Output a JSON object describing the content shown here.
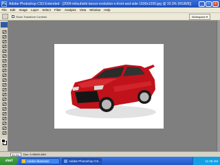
{
  "window": {
    "app_logo": "Ps",
    "title": "Adobe Photoshop CS3 Extended - [2009-mitsubishi-lancer-evolution-x-front-and-side 1600x1200.jpg @ 33.3% (RGB/8)]",
    "buttons": {
      "minimize": "_",
      "maximize": "□",
      "close": "×"
    }
  },
  "menubar": {
    "items": [
      "File",
      "Edit",
      "Image",
      "Layer",
      "Select",
      "Filter",
      "Analysis",
      "View",
      "Window",
      "Help"
    ]
  },
  "options": {
    "show_transform_label": "Show Transform Controls",
    "workspace_label": "Workspace ▾"
  },
  "toolbox": {
    "tools": [
      "move-icon",
      "marquee-icon",
      "lasso-icon",
      "magic-wand-icon",
      "crop-icon",
      "slice-icon",
      "healing-brush-icon",
      "brush-icon",
      "clone-stamp-icon",
      "history-brush-icon",
      "eraser-icon",
      "gradient-icon",
      "blur-icon",
      "dodge-icon",
      "pen-icon",
      "type-icon",
      "path-selection-icon",
      "shape-icon",
      "notes-icon",
      "eyedropper-icon",
      "hand-icon",
      "zoom-icon"
    ],
    "foreground_color": "#000000",
    "background_color": "#ffffff"
  },
  "statusbar": {
    "zoom": "33.3%",
    "doc_info": "Doc: 5.49M/5.49M"
  },
  "taskbar": {
    "start_label": "start",
    "tasks": [
      {
        "label": "Adobe Illustrator",
        "active": false
      },
      {
        "label": "Adobe Photoshop CS...",
        "active": true
      }
    ],
    "clock": "11:28 AM"
  },
  "colors": {
    "car_body": "#c0121a",
    "car_body_highlight": "#e0363a",
    "canvas_background": "#ffffff",
    "workspace_gray": "#7f7f7f"
  }
}
